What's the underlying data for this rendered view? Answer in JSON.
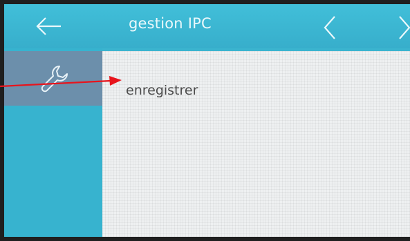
{
  "header": {
    "title": "gestion IPC",
    "back_icon": "arrow-left-icon",
    "prev_icon": "chevron-left-icon",
    "next_icon": "chevron-right-icon"
  },
  "sidebar": {
    "items": [
      {
        "icon": "wrench-icon",
        "selected": true
      }
    ]
  },
  "content": {
    "items": [
      {
        "label": "enregistrer"
      }
    ]
  },
  "annotation": {
    "color": "#e8141c"
  },
  "colors": {
    "header": "#3bb4cf",
    "sidebar_selected": "#6c8fab",
    "content_bg": "#eef0f1"
  }
}
